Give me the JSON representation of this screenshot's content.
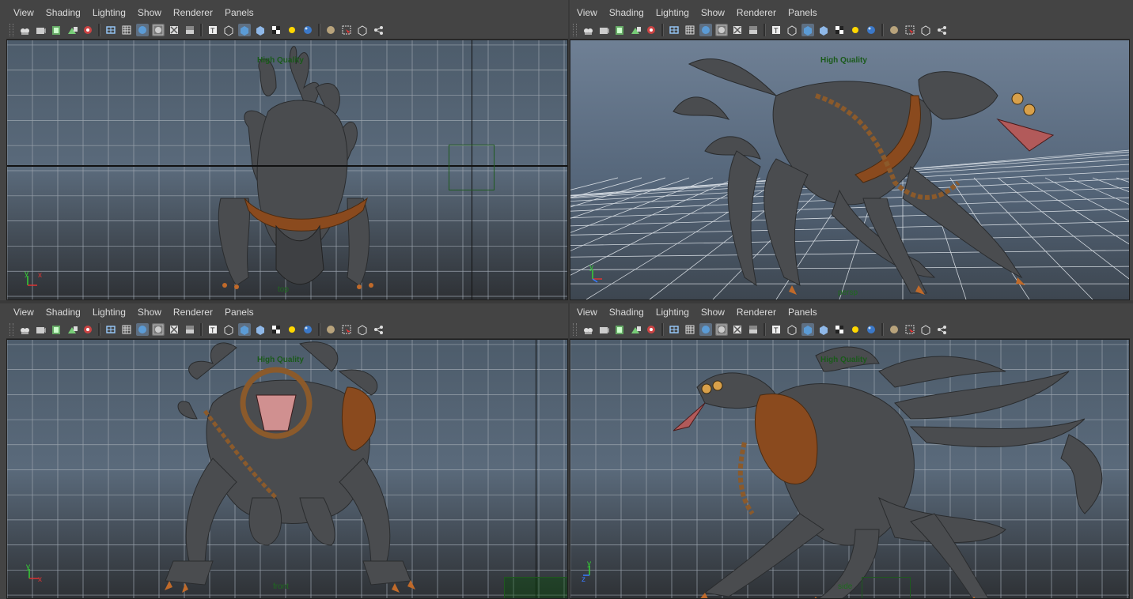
{
  "menus": [
    "View",
    "Shading",
    "Lighting",
    "Show",
    "Renderer",
    "Panels"
  ],
  "overlay": {
    "quality_label": "High Quality"
  },
  "panels": [
    {
      "camera": "top",
      "axis_v": "y",
      "axis_h": "x"
    },
    {
      "camera": "persp",
      "axis_v": "y",
      "axis_h": "x"
    },
    {
      "camera": "front",
      "axis_v": "y",
      "axis_h": "x"
    },
    {
      "camera": "side",
      "axis_v": "y",
      "axis_h": "z"
    }
  ],
  "toolbar_icons": [
    "camera-select-icon",
    "camera-attributes-icon",
    "bookmark-icon",
    "image-plane-icon",
    "two-d-pan-icon",
    "wireframe-icon",
    "smooth-shade-icon",
    "default-material-icon",
    "shaded-wireframe-icon",
    "xray-icon",
    "texture-icon",
    "isolate-select-icon",
    "use-lights-icon",
    "shadows-icon",
    "checker-icon",
    "high-quality-icon",
    "ambient-occlusion-icon",
    "antialias-icon",
    "select-camera-icon",
    "gate-icon",
    "resolution-gate-icon",
    "xray-joints-icon"
  ],
  "colors": {
    "ui_bg": "#444444",
    "menu_text": "#dcdcdc",
    "hq_text": "#1a5a1a",
    "creature_skin": "#4a4c4f",
    "leather": "#8a4a1e",
    "grid_line": "#9aa3ad"
  }
}
